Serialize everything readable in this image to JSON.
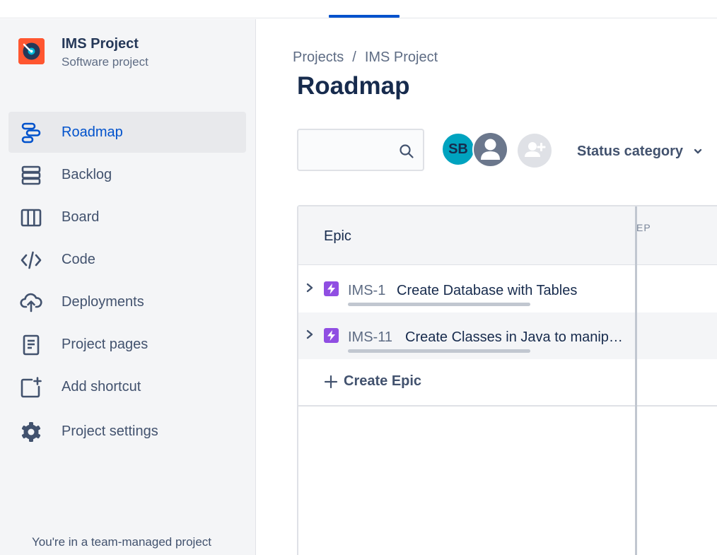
{
  "sidebar": {
    "project_name": "IMS Project",
    "project_type": "Software project",
    "items": [
      {
        "label": "Roadmap",
        "icon": "roadmap-icon",
        "selected": true
      },
      {
        "label": "Backlog",
        "icon": "backlog-icon"
      },
      {
        "label": "Board",
        "icon": "board-icon"
      },
      {
        "label": "Code",
        "icon": "code-icon"
      },
      {
        "label": "Deployments",
        "icon": "cloud-upload-icon"
      },
      {
        "label": "Project pages",
        "icon": "page-icon"
      },
      {
        "label": "Add shortcut",
        "icon": "add-shortcut-icon"
      },
      {
        "label": "Project settings",
        "icon": "gear-icon"
      }
    ],
    "footer_note": "You're in a team-managed project"
  },
  "breadcrumb": {
    "root": "Projects",
    "separator": "/",
    "current": "IMS Project"
  },
  "page": {
    "title": "Roadmap"
  },
  "toolbar": {
    "search_value": "",
    "avatar_initials": "SB",
    "status_filter_label": "Status category"
  },
  "grid": {
    "epic_column_label": "Epic",
    "timeline_label": "EP",
    "epics": [
      {
        "key": "IMS-1",
        "summary": "Create Database with Tables"
      },
      {
        "key": "IMS-11",
        "summary": "Create Classes in Java to manip…"
      }
    ],
    "create_label": "Create Epic"
  },
  "colors": {
    "accent": "#0052cc",
    "epic": "#904ee2",
    "avatar": "#00a3bf",
    "project_avatar": "#ff5630"
  }
}
